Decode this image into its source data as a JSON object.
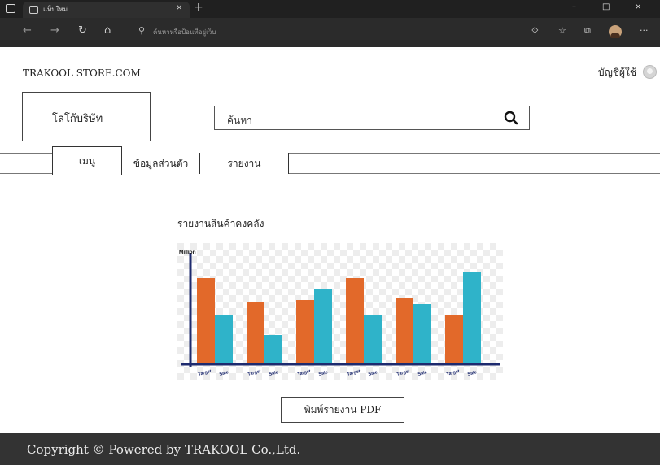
{
  "browser": {
    "tab_title": "แท็บใหม่",
    "tab_close": "×",
    "new_tab": "+",
    "address_placeholder": "ค้นหาหรือป้อนที่อยู่เว็บ",
    "window_controls": {
      "minimize": "–",
      "maximize": "□",
      "close": "×"
    },
    "more": "···"
  },
  "header": {
    "site_name": "TRAKOOL STORE.COM",
    "account_label": "บัญชีผู้ใช้"
  },
  "logo": {
    "label": "โลโก้บริษัท"
  },
  "search": {
    "value": "ค้นหา"
  },
  "nav": {
    "tabs": [
      {
        "label": "เมนู"
      },
      {
        "label": "ข้อมูลส่วนตัว"
      },
      {
        "label": "รายงาน"
      }
    ]
  },
  "report": {
    "title": "รายงานสินค้าคงคลัง",
    "pdf_button": "พิมพ์รายงาน PDF"
  },
  "chart_data": {
    "type": "bar",
    "ylabel": "Million",
    "categories": [
      "Target Sale",
      "Target Sale",
      "Target Sale",
      "Target Sale",
      "Target Sale",
      "Target Sale"
    ],
    "tick_labels": [
      "Target",
      "Sale"
    ],
    "series": [
      {
        "values": [
          105,
          75,
          78,
          105,
          80,
          60
        ],
        "color": "#e2692a"
      },
      {
        "values": [
          60,
          35,
          92,
          60,
          73,
          113
        ],
        "color": "#2fb3c9"
      }
    ],
    "ylim": [
      0,
      140
    ],
    "grid": false,
    "background": "checkered",
    "axis_color": "#1d2a6e"
  },
  "footer": {
    "text": "Copyright © Powered by TRAKOOL Co.,Ltd."
  }
}
